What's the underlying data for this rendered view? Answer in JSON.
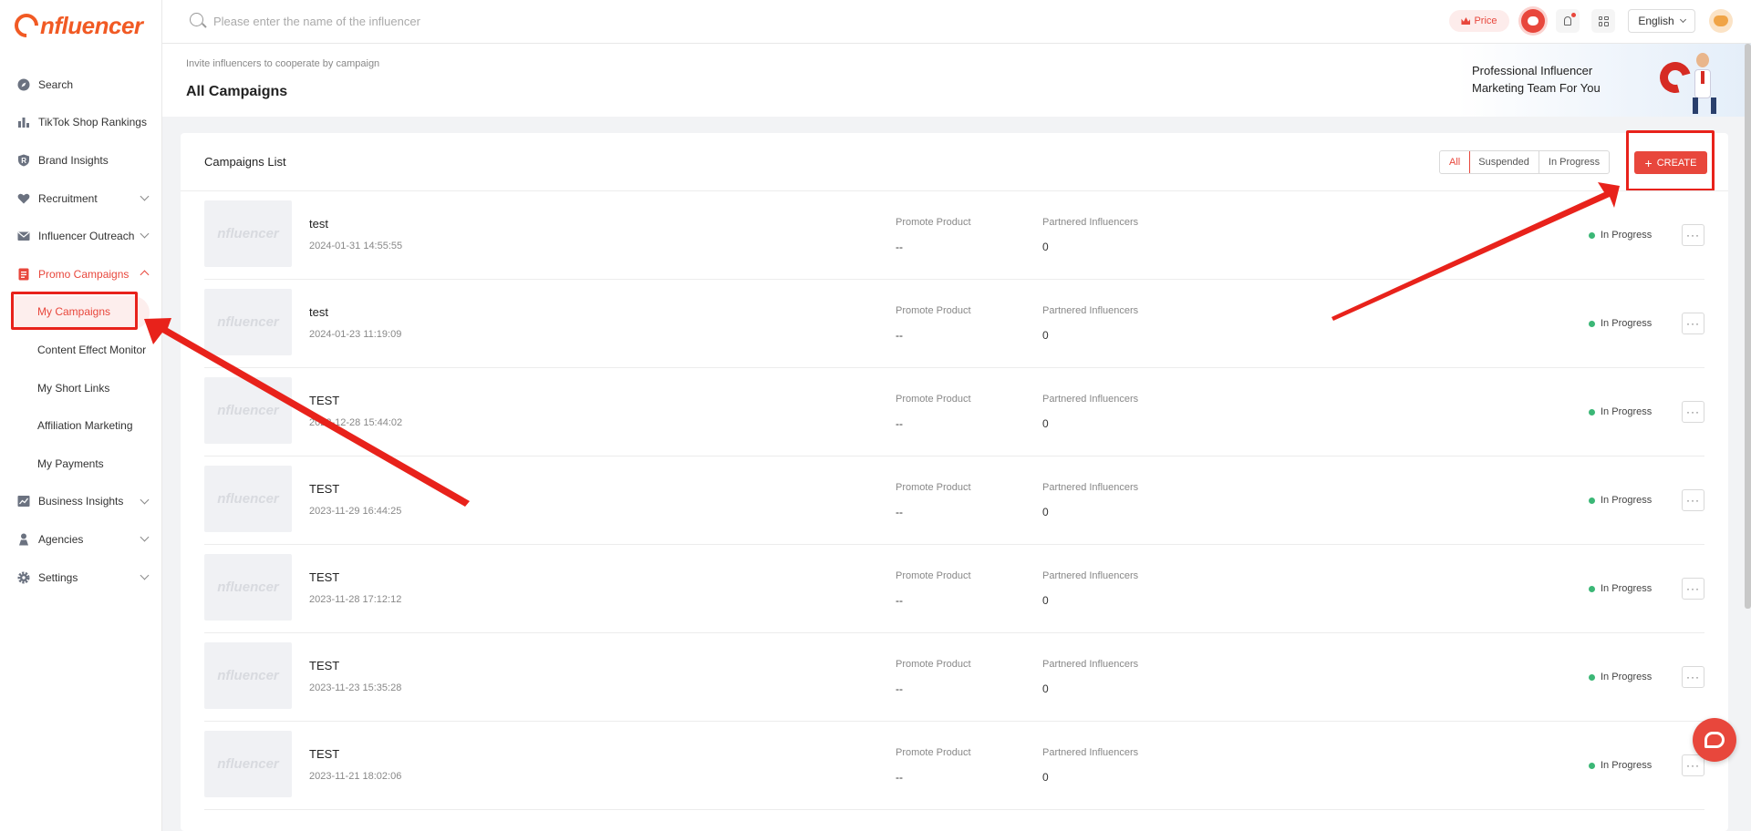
{
  "app": {
    "logo_text": "nfluencer"
  },
  "search": {
    "placeholder": "Please enter the name of the influencer"
  },
  "topbar": {
    "price_label": "Price",
    "language_label": "English"
  },
  "sidebar": {
    "items": [
      {
        "label": "Search",
        "icon": "compass-icon"
      },
      {
        "label": "TikTok Shop Rankings",
        "icon": "bar-chart-icon"
      },
      {
        "label": "Brand Insights",
        "icon": "brand-shield-icon"
      },
      {
        "label": "Recruitment",
        "icon": "heart-icon"
      },
      {
        "label": "Influencer Outreach",
        "icon": "mail-icon"
      },
      {
        "label": "Promo Campaigns",
        "icon": "document-icon"
      },
      {
        "label": "Business Insights",
        "icon": "trend-icon"
      },
      {
        "label": "Agencies",
        "icon": "person-icon"
      },
      {
        "label": "Settings",
        "icon": "gear-icon"
      }
    ],
    "promo_sub_items": [
      {
        "label": "My Campaigns"
      },
      {
        "label": "Content Effect Monitor"
      },
      {
        "label": "My Short Links"
      },
      {
        "label": "Affiliation Marketing"
      },
      {
        "label": "My Payments"
      }
    ]
  },
  "header": {
    "subtitle": "Invite influencers to cooperate by campaign",
    "title": "All Campaigns",
    "banner_line1": "Professional Influencer",
    "banner_line2": "Marketing Team For You"
  },
  "campaigns": {
    "list_title": "Campaigns List",
    "filters": [
      "All",
      "Suspended",
      "In Progress"
    ],
    "create_label": "CREATE",
    "thumb_text": "nfluencer",
    "col_product_label": "Promote Product",
    "col_influencers_label": "Partnered Influencers",
    "rows": [
      {
        "name": "test",
        "date": "2024-01-31 14:55:55",
        "product": "--",
        "influencers": "0",
        "status": "In Progress"
      },
      {
        "name": "test",
        "date": "2024-01-23 11:19:09",
        "product": "--",
        "influencers": "0",
        "status": "In Progress"
      },
      {
        "name": "TEST",
        "date": "2023-12-28 15:44:02",
        "product": "--",
        "influencers": "0",
        "status": "In Progress"
      },
      {
        "name": "TEST",
        "date": "2023-11-29 16:44:25",
        "product": "--",
        "influencers": "0",
        "status": "In Progress"
      },
      {
        "name": "TEST",
        "date": "2023-11-28 17:12:12",
        "product": "--",
        "influencers": "0",
        "status": "In Progress"
      },
      {
        "name": "TEST",
        "date": "2023-11-23 15:35:28",
        "product": "--",
        "influencers": "0",
        "status": "In Progress"
      },
      {
        "name": "TEST",
        "date": "2023-11-21 18:02:06",
        "product": "--",
        "influencers": "0",
        "status": "In Progress"
      }
    ]
  },
  "colors": {
    "accent": "#e8473c",
    "status_green": "#3bb776",
    "annotation_red": "#e8221b"
  }
}
